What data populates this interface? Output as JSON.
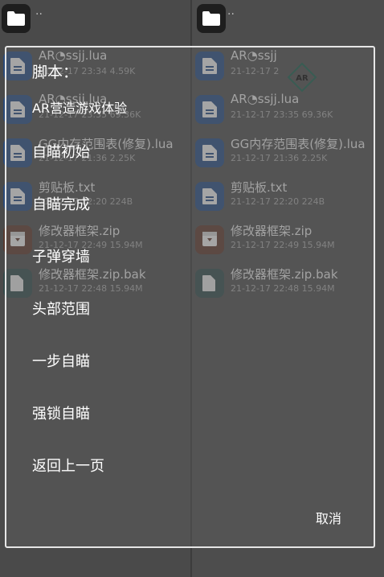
{
  "left_pane": {
    "up_label": "..",
    "files": [
      {
        "name": "AR◔ssjj.lua",
        "meta": "21-12-17 23:34  4.59K",
        "icon": "lua-file-icon",
        "color": "#2a4a7a"
      },
      {
        "name": "AR◔ssjj.lua",
        "meta": "21-12-17 23:35  69.36K",
        "icon": "lua-file-icon",
        "color": "#2a4a7a"
      },
      {
        "name": "GG内存范围表(修复).lua",
        "meta": "21-12-17 21:36  2.25K",
        "icon": "lua-file-icon",
        "color": "#2a4a7a"
      },
      {
        "name": "剪贴板.txt",
        "meta": "21-12-17 22:20  224B",
        "icon": "text-file-icon",
        "color": "#2a4a7a"
      },
      {
        "name": "修改器框架.zip",
        "meta": "21-12-17 22:49  15.94M",
        "icon": "archive-icon",
        "color": "#5a3a30"
      },
      {
        "name": "修改器框架.zip.bak",
        "meta": "21-12-17 22:48  15.94M",
        "icon": "generic-file-icon",
        "color": "#344a4a"
      }
    ]
  },
  "right_pane": {
    "up_label": "..",
    "files": [
      {
        "name": "AR◔ssjj",
        "meta": "21-12-17 2",
        "icon": "lua-file-icon",
        "color": "#2a4a7a"
      },
      {
        "name": "AR◔ssjj.lua",
        "meta": "21-12-17 23:35  69.36K",
        "icon": "lua-file-icon",
        "color": "#2a4a7a"
      },
      {
        "name": "GG内存范围表(修复).lua",
        "meta": "21-12-17 21:36  2.25K",
        "icon": "lua-file-icon",
        "color": "#2a4a7a"
      },
      {
        "name": "剪贴板.txt",
        "meta": "21-12-17 22:20  224B",
        "icon": "text-file-icon",
        "color": "#2a4a7a"
      },
      {
        "name": "修改器框架.zip",
        "meta": "21-12-17 22:49  15.94M",
        "icon": "archive-icon",
        "color": "#5a3a30"
      },
      {
        "name": "修改器框架.zip.bak",
        "meta": "21-12-17 22:48  15.94M",
        "icon": "generic-file-icon",
        "color": "#344a4a"
      }
    ],
    "watermark_text": "AR"
  },
  "dialog": {
    "title": "脚本：",
    "items": [
      "AR营造游戏体验",
      "自瞄初始",
      "自瞄完成",
      "子弹穿墙",
      "头部范围",
      "一步自瞄",
      "强锁自瞄",
      "返回上一页"
    ],
    "cancel_label": "取消"
  }
}
